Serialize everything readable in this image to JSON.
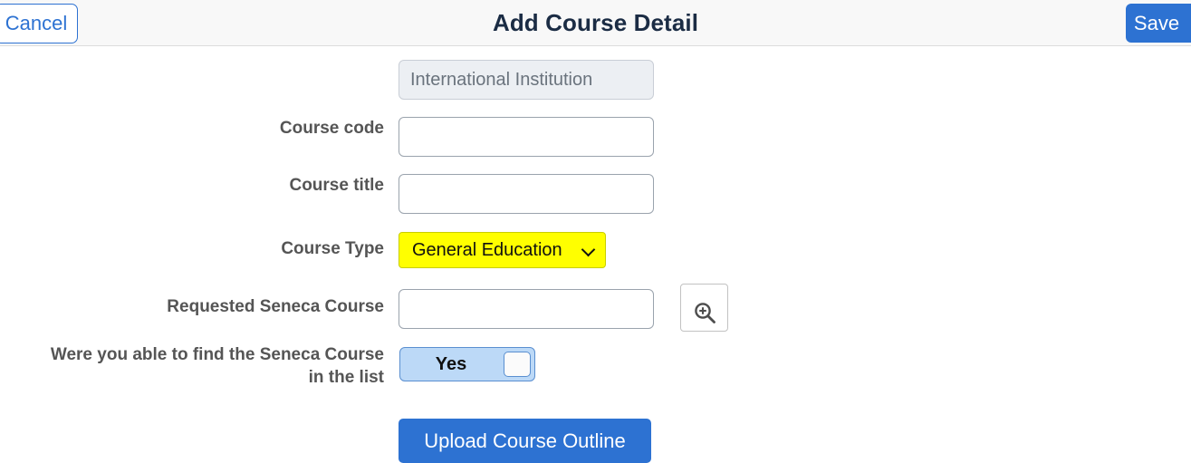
{
  "header": {
    "title": "Add Course Detail",
    "cancel_label": "Cancel",
    "save_label": "Save"
  },
  "colors": {
    "accent_blue": "#2d72d2",
    "highlight_yellow": "#ffff00",
    "toggle_blue": "#bcd9f7",
    "header_bg": "#f8f8f8",
    "label_gray": "#555555"
  },
  "form": {
    "institution": {
      "label": "",
      "value": "International Institution",
      "disabled": true
    },
    "course_code": {
      "label": "Course code",
      "value": "",
      "placeholder": ""
    },
    "course_title": {
      "label": "Course title",
      "value": "",
      "placeholder": ""
    },
    "course_type": {
      "label": "Course Type",
      "selected": "General Education",
      "icon": "chevron-down-icon"
    },
    "requested_seneca_course": {
      "label": "Requested Seneca Course",
      "value": "",
      "placeholder": "",
      "search_icon": "magnifier-plus-icon"
    },
    "found_in_list": {
      "label": "Were you able to find the Seneca Course in the list",
      "state": "Yes"
    }
  },
  "actions": {
    "upload_label": "Upload Course Outline"
  }
}
